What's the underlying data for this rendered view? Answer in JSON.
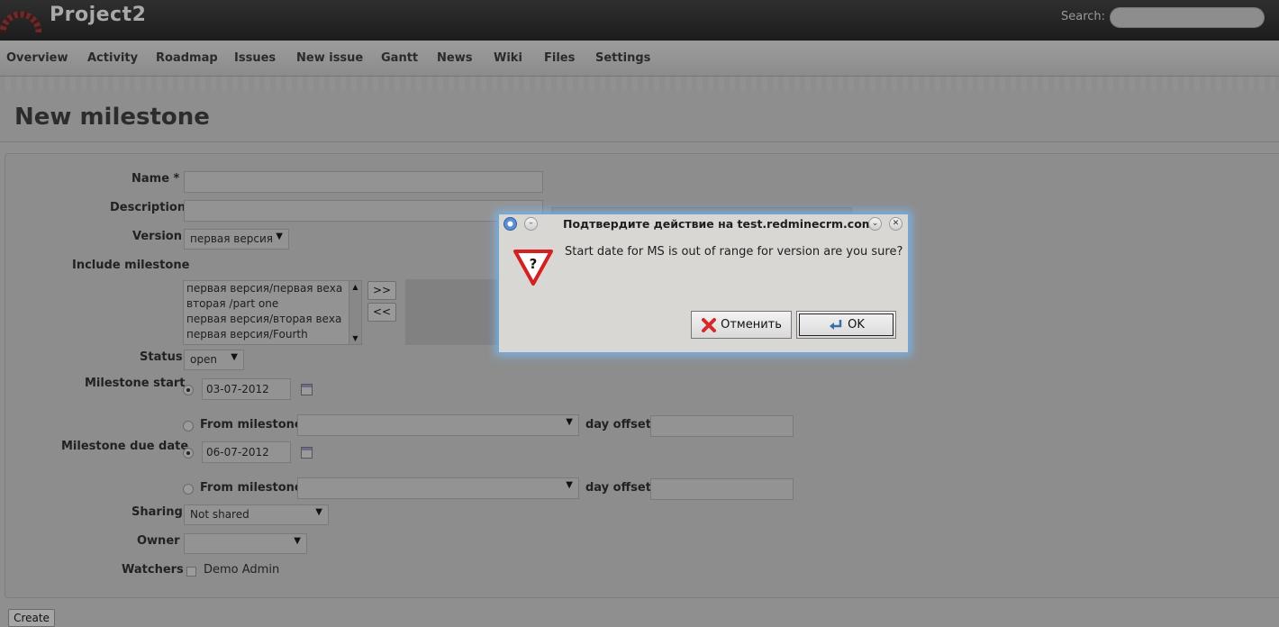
{
  "header": {
    "project_title": "Project2",
    "search_label": "Search:",
    "search_value": ""
  },
  "menu": {
    "items": [
      "Overview",
      "Activity",
      "Roadmap",
      "Issues",
      "New issue",
      "Gantt",
      "News",
      "Wiki",
      "Files",
      "Settings"
    ]
  },
  "page": {
    "title": "New milestone"
  },
  "form": {
    "name_label": "Name",
    "required_mark": "*",
    "description_label": "Description",
    "version_label": "Version",
    "version_value": "первая версия",
    "include_label": "Include milestone",
    "include_options": [
      "первая версия/первая веха",
      "вторая /part one",
      "первая версия/вторая веха",
      "первая версия/Fourth"
    ],
    "move_right": ">>",
    "move_left": "<<",
    "status_label": "Status",
    "status_value": "open",
    "start_label": "Milestone start",
    "start_date": "03-07-2012",
    "from_milestone_label": "From milestone",
    "day_offset_label": "day offset",
    "due_label": "Milestone due date",
    "due_date": "06-07-2012",
    "sharing_label": "Sharing",
    "sharing_value": "Not shared",
    "owner_label": "Owner",
    "owner_value": "",
    "watchers_label": "Watchers",
    "watcher_name": "Demo Admin",
    "create_label": "Create"
  },
  "dialog": {
    "title": "Подтвердите действие на test.redminecrm.com",
    "message": "Start date for MS is out of range for version are you sure?",
    "cancel_label": "Отменить",
    "ok_label": "OK"
  }
}
